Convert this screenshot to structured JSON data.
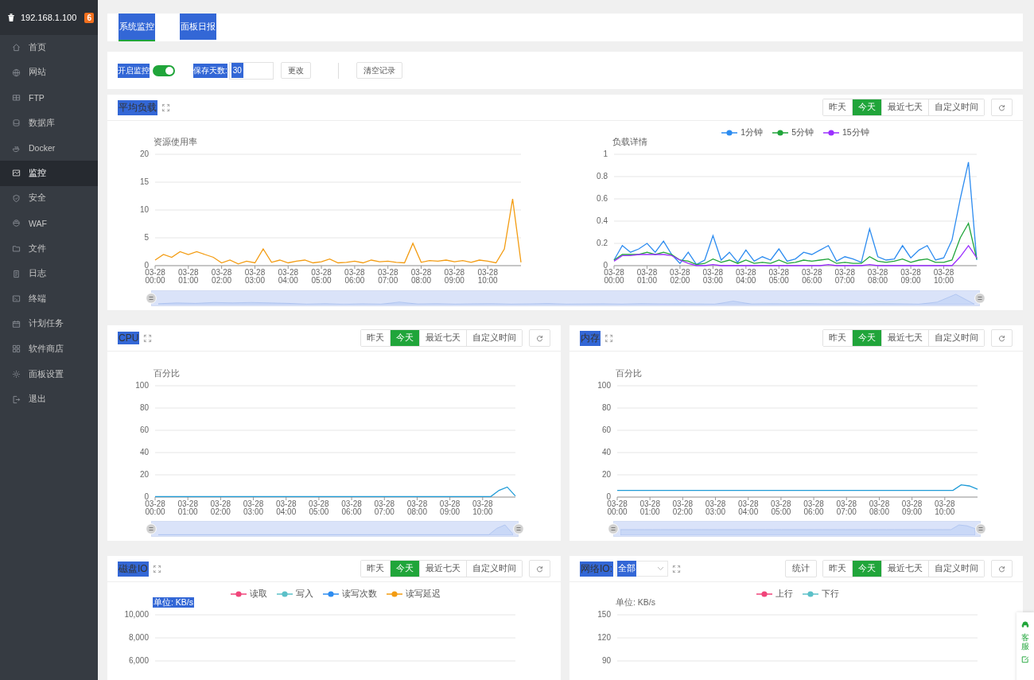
{
  "sidebar": {
    "host": "192.168.1.100",
    "badge": "6",
    "items": [
      {
        "label": "首页",
        "selected": false
      },
      {
        "label": "网站",
        "selected": false
      },
      {
        "label": "FTP",
        "selected": false
      },
      {
        "label": "数据库",
        "selected": false
      },
      {
        "label": "Docker",
        "selected": false
      },
      {
        "label": "监控",
        "selected": true
      },
      {
        "label": "安全",
        "selected": false
      },
      {
        "label": "WAF",
        "selected": false
      },
      {
        "label": "文件",
        "selected": false
      },
      {
        "label": "日志",
        "selected": false
      },
      {
        "label": "终端",
        "selected": false
      },
      {
        "label": "计划任务",
        "selected": false
      },
      {
        "label": "软件商店",
        "selected": false
      },
      {
        "label": "面板设置",
        "selected": false
      },
      {
        "label": "退出",
        "selected": false
      }
    ]
  },
  "tabs": [
    {
      "label": "系统监控",
      "selected": true,
      "highlighted": true
    },
    {
      "label": "面板日报",
      "selected": false,
      "highlighted": true
    }
  ],
  "controls": {
    "monitor_label": "开启监控",
    "monitor_label_highlighted": true,
    "monitor_on": true,
    "days_label": "保存天数:",
    "days_label_highlighted": true,
    "days_value": "30",
    "days_value_highlighted": true,
    "change_button": "更改",
    "clear_button": "清空记录"
  },
  "panels": [
    {
      "kind": "load",
      "title": "平均负载",
      "highlighted": true,
      "ranges": [
        {
          "label": "昨天",
          "selected": false
        },
        {
          "label": "今天",
          "selected": true
        },
        {
          "label": "最近七天",
          "selected": false
        },
        {
          "label": "自定义时间",
          "selected": false
        }
      ],
      "zoom": {
        "level": 1
      },
      "charts": [
        {
          "ylabel_highlighted": false,
          "chart_data": {
            "type": "line",
            "grid": true,
            "ylabel": "资源使用率",
            "ylim": [
              0,
              20
            ],
            "yticks": [
              0,
              5,
              10,
              15,
              20
            ],
            "categories": [
              "03-28 00:00",
              null,
              null,
              null,
              "03-28 01:00",
              null,
              null,
              null,
              "03-28 02:00",
              null,
              null,
              null,
              "03-28 03:00",
              null,
              null,
              null,
              "03-28 04:00",
              null,
              null,
              null,
              "03-28 05:00",
              null,
              null,
              null,
              "03-28 06:00",
              null,
              null,
              null,
              "03-28 07:00",
              null,
              null,
              null,
              "03-28 08:00",
              null,
              null,
              null,
              "03-28 09:00",
              null,
              null,
              null,
              "03-28 10:00",
              null,
              null,
              null,
              null
            ],
            "series": [
              {
                "color": "#f39c12",
                "values": [
                  1,
                  2,
                  1.5,
                  2.5,
                  2,
                  2.5,
                  2,
                  1.5,
                  0.5,
                  1,
                  0.3,
                  0.8,
                  0.5,
                  3,
                  0.6,
                  1,
                  0.5,
                  0.8,
                  1,
                  0.5,
                  0.7,
                  1.2,
                  0.5,
                  0.6,
                  0.8,
                  0.5,
                  1,
                  0.7,
                  0.8,
                  0.6,
                  0.5,
                  4,
                  0.6,
                  0.9,
                  0.8,
                  1,
                  0.7,
                  0.9,
                  0.6,
                  1,
                  0.8,
                  0.5,
                  3,
                  12,
                  0.6
                ]
              }
            ]
          }
        },
        {
          "ylabel_highlighted": false,
          "chart_data": {
            "type": "line",
            "grid": true,
            "legend": "top",
            "ylabel": "负载详情",
            "ylim": [
              0,
              1
            ],
            "yticks": [
              0,
              0.2,
              0.4,
              0.6,
              0.8,
              1
            ],
            "categories": [
              "03-28 00:00",
              null,
              null,
              null,
              "03-28 01:00",
              null,
              null,
              null,
              "03-28 02:00",
              null,
              null,
              null,
              "03-28 03:00",
              null,
              null,
              null,
              "03-28 04:00",
              null,
              null,
              null,
              "03-28 05:00",
              null,
              null,
              null,
              "03-28 06:00",
              null,
              null,
              null,
              "03-28 07:00",
              null,
              null,
              null,
              "03-28 08:00",
              null,
              null,
              null,
              "03-28 09:00",
              null,
              null,
              null,
              "03-28 10:00",
              null,
              null,
              null,
              null
            ],
            "series": [
              {
                "name": "1分钟",
                "color": "#2d8cf0",
                "values": [
                  0.05,
                  0.18,
                  0.12,
                  0.15,
                  0.2,
                  0.12,
                  0.22,
                  0.1,
                  0.02,
                  0.12,
                  0.01,
                  0.05,
                  0.27,
                  0.05,
                  0.12,
                  0.03,
                  0.14,
                  0.04,
                  0.08,
                  0.05,
                  0.15,
                  0.04,
                  0.06,
                  0.12,
                  0.1,
                  0.14,
                  0.18,
                  0.04,
                  0.08,
                  0.06,
                  0.03,
                  0.33,
                  0.08,
                  0.05,
                  0.06,
                  0.18,
                  0.07,
                  0.14,
                  0.18,
                  0.05,
                  0.07,
                  0.23,
                  0.6,
                  0.93,
                  0.05
                ]
              },
              {
                "name": "5分钟",
                "color": "#20a53a",
                "values": [
                  0.05,
                  0.1,
                  0.1,
                  0.1,
                  0.12,
                  0.1,
                  0.12,
                  0.1,
                  0.05,
                  0.04,
                  0.01,
                  0.02,
                  0.06,
                  0.03,
                  0.05,
                  0.02,
                  0.05,
                  0.02,
                  0.03,
                  0.02,
                  0.05,
                  0.02,
                  0.03,
                  0.05,
                  0.04,
                  0.05,
                  0.06,
                  0.02,
                  0.03,
                  0.02,
                  0.02,
                  0.08,
                  0.04,
                  0.03,
                  0.04,
                  0.06,
                  0.03,
                  0.05,
                  0.06,
                  0.03,
                  0.03,
                  0.05,
                  0.25,
                  0.38,
                  0.06
                ]
              },
              {
                "name": "15分钟",
                "color": "#9b30ff",
                "values": [
                  0.04,
                  0.09,
                  0.09,
                  0.1,
                  0.1,
                  0.1,
                  0.1,
                  0.09,
                  0.05,
                  0.02,
                  0,
                  0,
                  0.01,
                  0,
                  0,
                  0,
                  0,
                  0,
                  0,
                  0,
                  0,
                  0,
                  0,
                  0,
                  0,
                  0,
                  0.01,
                  0,
                  0,
                  0,
                  0,
                  0.01,
                  0,
                  0,
                  0,
                  0,
                  0,
                  0,
                  0,
                  0,
                  0,
                  0,
                  0.08,
                  0.18,
                  0.07
                ]
              }
            ]
          }
        }
      ]
    },
    {
      "kind": "single",
      "title": "CPU",
      "highlighted": true,
      "ranges": [
        {
          "label": "昨天",
          "selected": false
        },
        {
          "label": "今天",
          "selected": true
        },
        {
          "label": "最近七天",
          "selected": false
        },
        {
          "label": "自定义时间",
          "selected": false
        }
      ],
      "zoom": {
        "level": 1
      },
      "charts": [
        {
          "ylabel_highlighted": false,
          "chart_data": {
            "type": "line",
            "grid": true,
            "ylabel": "百分比",
            "ylim": [
              0,
              100
            ],
            "yticks": [
              0,
              20,
              40,
              60,
              80,
              100
            ],
            "categories": [
              "03-28 00:00",
              null,
              null,
              null,
              "03-28 01:00",
              null,
              null,
              null,
              "03-28 02:00",
              null,
              null,
              null,
              "03-28 03:00",
              null,
              null,
              null,
              "03-28 04:00",
              null,
              null,
              null,
              "03-28 05:00",
              null,
              null,
              null,
              "03-28 06:00",
              null,
              null,
              null,
              "03-28 07:00",
              null,
              null,
              null,
              "03-28 08:00",
              null,
              null,
              null,
              "03-28 09:00",
              null,
              null,
              null,
              "03-28 10:00",
              null,
              null,
              null,
              null
            ],
            "series": [
              {
                "color": "#1e9bd7",
                "values": [
                  0.5,
                  0.5,
                  0.5,
                  0.5,
                  0.5,
                  0.5,
                  0.5,
                  0.5,
                  0.5,
                  0.5,
                  0.5,
                  0.5,
                  0.5,
                  0.5,
                  0.5,
                  0.5,
                  0.5,
                  0.5,
                  0.5,
                  0.5,
                  0.5,
                  0.5,
                  0.5,
                  0.5,
                  0.5,
                  0.5,
                  0.5,
                  0.5,
                  0.5,
                  0.5,
                  0.5,
                  0.5,
                  0.5,
                  0.5,
                  0.5,
                  0.5,
                  0.5,
                  0.5,
                  0.5,
                  0.5,
                  0.5,
                  0.5,
                  6,
                  9,
                  1
                ]
              }
            ]
          }
        }
      ]
    },
    {
      "kind": "single",
      "title": "内存",
      "highlighted": true,
      "ranges": [
        {
          "label": "昨天",
          "selected": false
        },
        {
          "label": "今天",
          "selected": true
        },
        {
          "label": "最近七天",
          "selected": false
        },
        {
          "label": "自定义时间",
          "selected": false
        }
      ],
      "zoom": {
        "level": 1
      },
      "charts": [
        {
          "ylabel_highlighted": false,
          "chart_data": {
            "type": "line",
            "grid": true,
            "ylabel": "百分比",
            "ylim": [
              0,
              100
            ],
            "yticks": [
              0,
              20,
              40,
              60,
              80,
              100
            ],
            "categories": [
              "03-28 00:00",
              null,
              null,
              null,
              "03-28 01:00",
              null,
              null,
              null,
              "03-28 02:00",
              null,
              null,
              null,
              "03-28 03:00",
              null,
              null,
              null,
              "03-28 04:00",
              null,
              null,
              null,
              "03-28 05:00",
              null,
              null,
              null,
              "03-28 06:00",
              null,
              null,
              null,
              "03-28 07:00",
              null,
              null,
              null,
              "03-28 08:00",
              null,
              null,
              null,
              "03-28 09:00",
              null,
              null,
              null,
              "03-28 10:00",
              null,
              null,
              null,
              null
            ],
            "series": [
              {
                "color": "#1e9bd7",
                "values": [
                  6,
                  6,
                  6,
                  6,
                  6,
                  6,
                  6,
                  6,
                  6,
                  6,
                  6,
                  6,
                  6,
                  6,
                  6,
                  6,
                  6,
                  6,
                  6,
                  6,
                  6,
                  6,
                  6,
                  6,
                  6,
                  6,
                  6,
                  6,
                  6,
                  6,
                  6,
                  6,
                  6,
                  6,
                  6,
                  6,
                  6,
                  6,
                  6,
                  6,
                  6,
                  6,
                  11,
                  10,
                  7
                ]
              }
            ]
          }
        }
      ]
    },
    {
      "kind": "disk",
      "title": "磁盘IO",
      "highlighted": true,
      "ranges": [
        {
          "label": "昨天",
          "selected": false
        },
        {
          "label": "今天",
          "selected": true
        },
        {
          "label": "最近七天",
          "selected": false
        },
        {
          "label": "自定义时间",
          "selected": false
        }
      ],
      "charts": [
        {
          "ylabel_highlighted": true,
          "chart_data": {
            "type": "line",
            "grid": true,
            "legend": "top",
            "ylabel": "单位: KB/s",
            "ylim": [
              6000,
              10000
            ],
            "yticks": [
              {
                "value": 6000,
                "label": "6,000"
              },
              {
                "value": 8000,
                "label": "8,000"
              },
              {
                "value": 10000,
                "label": "10,000"
              }
            ],
            "series": [
              {
                "name": "读取",
                "color": "#f0457a"
              },
              {
                "name": "写入",
                "color": "#5bc0c8"
              },
              {
                "name": "读写次数",
                "color": "#2d8cf0"
              },
              {
                "name": "读写延迟",
                "color": "#f39c12"
              }
            ]
          }
        }
      ]
    },
    {
      "kind": "network",
      "title": "网络IO:",
      "highlighted": true,
      "select": "全部",
      "select_highlighted": true,
      "stat_button": "统计",
      "ranges": [
        {
          "label": "昨天",
          "selected": false
        },
        {
          "label": "今天",
          "selected": true
        },
        {
          "label": "最近七天",
          "selected": false
        },
        {
          "label": "自定义时间",
          "selected": false
        }
      ],
      "charts": [
        {
          "ylabel_highlighted": false,
          "chart_data": {
            "type": "line",
            "grid": true,
            "legend": "top",
            "ylabel": "单位: KB/s",
            "ylim": [
              90,
              150
            ],
            "yticks": [
              90,
              120,
              150
            ],
            "series": [
              {
                "name": "上行",
                "color": "#f0457a"
              },
              {
                "name": "下行",
                "color": "#5bc0c8"
              }
            ]
          }
        }
      ]
    }
  ],
  "float_widget": {
    "label": "客服"
  }
}
